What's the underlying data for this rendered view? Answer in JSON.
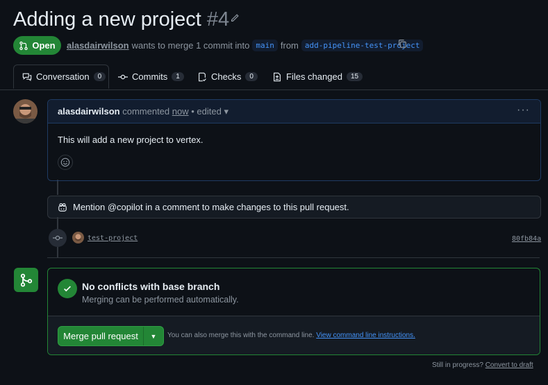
{
  "header": {
    "title": "Adding a new project",
    "number": "#4",
    "status": "Open",
    "author": "alasdairwilson",
    "merge_text": "wants to merge 1 commit into",
    "base_branch": "main",
    "from_text": "from",
    "head_branch": "add-pipeline-test-project"
  },
  "tabs": [
    {
      "label": "Conversation",
      "count": "0"
    },
    {
      "label": "Commits",
      "count": "1"
    },
    {
      "label": "Checks",
      "count": "0"
    },
    {
      "label": "Files changed",
      "count": "15"
    }
  ],
  "comment": {
    "author": "alasdairwilson",
    "action": "commented",
    "time": "now",
    "edited": "• edited",
    "body": "This will add a new project to vertex."
  },
  "copilot_tip": "Mention @copilot in a comment to make changes to this pull request.",
  "commit": {
    "message": "test-project",
    "sha": "80fb84a"
  },
  "merge": {
    "title": "No conflicts with base branch",
    "subtitle": "Merging can be performed automatically.",
    "button_label": "Merge pull request",
    "cli_text": "You can also merge this with the command line.",
    "cli_link": "View command line instructions."
  },
  "footer": {
    "progress_text": "Still in progress?",
    "draft_link": "Convert to draft"
  },
  "colors": {
    "accent_green": "#238636",
    "link_blue": "#4493f8",
    "background": "#0d1117"
  }
}
